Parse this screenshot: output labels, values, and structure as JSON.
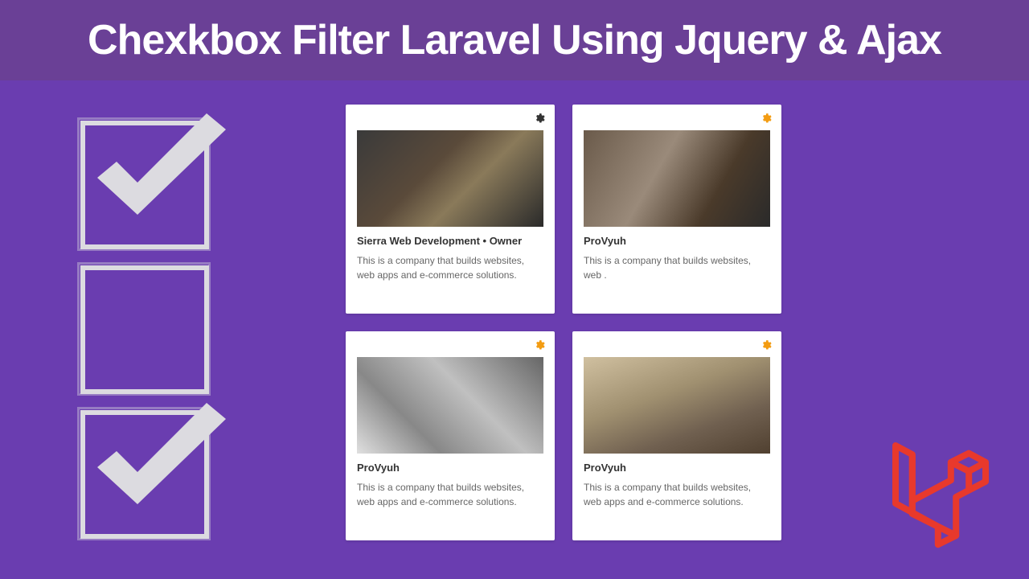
{
  "header": {
    "title": "Chexkbox Filter Laravel Using Jquery & Ajax"
  },
  "sidebar": {
    "checkboxes": [
      {
        "checked": true
      },
      {
        "checked": false
      },
      {
        "checked": true
      }
    ]
  },
  "cards": [
    {
      "title": "Sierra Web Development • Owner",
      "description": "This is a company that builds websites, web apps and e-commerce solutions.",
      "gear_color": "dark"
    },
    {
      "title": "ProVyuh",
      "description": "This is a company that builds websites, web .",
      "gear_color": "orange"
    },
    {
      "title": "ProVyuh",
      "description": "This is a company that builds websites, web apps and e-commerce solutions.",
      "gear_color": "orange"
    },
    {
      "title": "ProVyuh",
      "description": "This is a company that builds websites, web apps and e-commerce solutions.",
      "gear_color": "orange"
    }
  ],
  "logo": {
    "name": "Laravel"
  }
}
